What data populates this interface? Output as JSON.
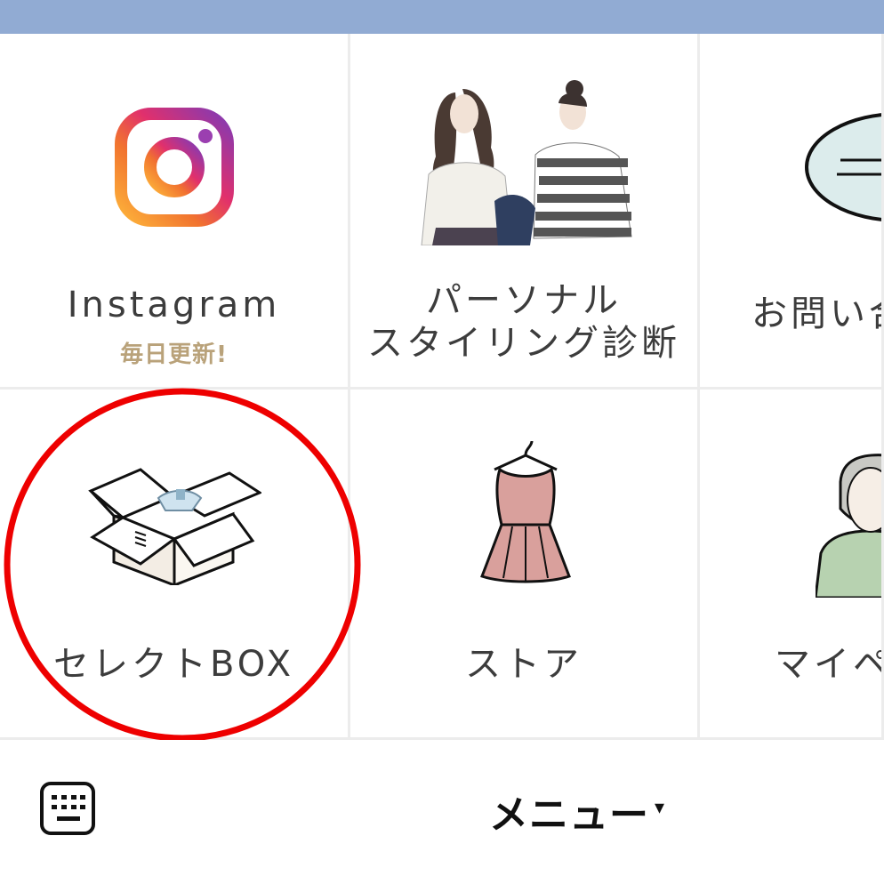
{
  "menu": {
    "items": [
      {
        "label": "Instagram",
        "badge": "毎日更新!"
      },
      {
        "label_line1": "パーソナル",
        "label_line2": "スタイリング診断"
      },
      {
        "label": "お問い合"
      },
      {
        "label": "セレクトBOX"
      },
      {
        "label": "ストア"
      },
      {
        "label": "マイペ"
      }
    ]
  },
  "bottom_bar": {
    "menu_label": "メニュー",
    "caret": "▾"
  },
  "colors": {
    "top_bar": "#91abd3",
    "highlight": "#ee0000",
    "badge": "#b9a27a"
  },
  "icons": [
    "instagram-icon",
    "stylists-illustration",
    "chat-bubble-icon",
    "open-box-icon",
    "dress-on-hanger-icon",
    "person-avatar-icon",
    "keyboard-icon"
  ]
}
